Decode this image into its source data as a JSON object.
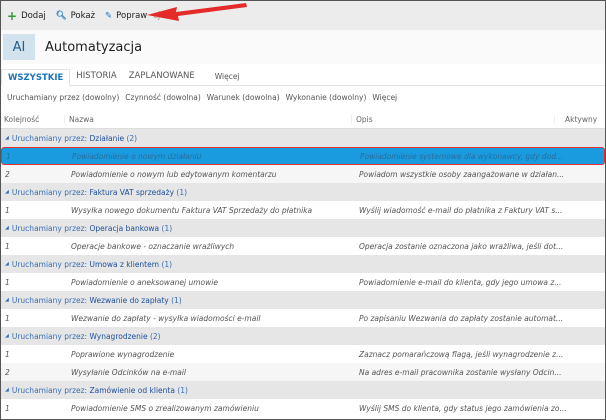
{
  "toolbar": {
    "add": "Dodaj",
    "show": "Pokaż",
    "edit": "Popraw",
    "hidden": "cje"
  },
  "header": {
    "badge": "AI",
    "title": "Automatyzacja"
  },
  "tabs": [
    "WSZYSTKIE",
    "HISTORIA",
    "ZAPLANOWANE",
    "Więcej"
  ],
  "filters": [
    "Uruchamiany przez (dowolny)",
    "Czynność (dowolna)",
    "Warunek (dowolna)",
    "Wykonanie (dowolny)",
    "Więcej"
  ],
  "columns": [
    "Kolejność",
    "Nazwa",
    "Opis",
    "Aktywny"
  ],
  "group_prefix": "Uruchamiany przez:",
  "groups": [
    {
      "name": "Działanie",
      "count": "(2)",
      "rows": [
        {
          "order": "1",
          "name": "Powiadomienie o nowym działaniu",
          "desc": "Powiadomienie systemowe dla wykonawcy, gdy dod...",
          "selected": true
        },
        {
          "order": "2",
          "name": "Powiadomienie o nowym lub edytowanym komentarzu",
          "desc": "Powiadom wszystkie osoby zaangażowane w działan..."
        }
      ]
    },
    {
      "name": "Faktura VAT sprzedaży",
      "count": "(1)",
      "rows": [
        {
          "order": "1",
          "name": "Wysyłka nowego dokumentu Faktura VAT Sprzedaży do płatnika",
          "desc": "Wyślij wiadomość e-mail do płatnika z Faktury VAT s..."
        }
      ]
    },
    {
      "name": "Operacja bankowa",
      "count": "(1)",
      "rows": [
        {
          "order": "1",
          "name": "Operacje bankowe - oznaczanie wrażliwych",
          "desc": "Operacja zostanie oznaczona jako wrażliwa, jeśli dot..."
        }
      ]
    },
    {
      "name": "Umowa z klientem",
      "count": "(1)",
      "rows": [
        {
          "order": "1",
          "name": "Powiadomienie o aneksowanej umowie",
          "desc": "Powiadomienie e-mail do klienta, gdy jego umowa z..."
        }
      ]
    },
    {
      "name": "Wezwanie do zapłaty",
      "count": "(1)",
      "rows": [
        {
          "order": "1",
          "name": "Wezwanie do zapłaty - wysyłka wiadomości e-mail",
          "desc": "Po zapisaniu Wezwania do zapłaty zostanie automat..."
        }
      ]
    },
    {
      "name": "Wynagrodzenie",
      "count": "(2)",
      "rows": [
        {
          "order": "1",
          "name": "Poprawione wynagrodzenie",
          "desc": "Zaznacz pomarańczową flagą, jeśli wynagrodzenie z..."
        },
        {
          "order": "2",
          "name": "Wysyłanie Odcinków na e-mail",
          "desc": "Na adres e-mail pracownika zostanie wysłany Odcin..."
        }
      ]
    },
    {
      "name": "Zamówienie od klienta",
      "count": "(1)",
      "rows": [
        {
          "order": "1",
          "name": "Powiadomienie SMS o zrealizowanym zamówieniu",
          "desc": "Wyślij SMS do klienta, gdy status jego zamówienia zo..."
        }
      ]
    }
  ],
  "colors": {
    "accent": "#1b75bb",
    "selected": "#1a9be0",
    "annotation": "#e23030"
  }
}
